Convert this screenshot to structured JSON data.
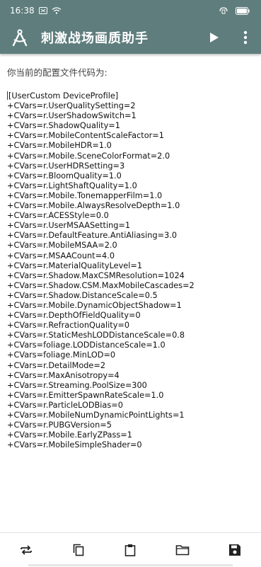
{
  "status_bar": {
    "time": "16:38",
    "battery_icon": "battery-icon",
    "wifi_icon": "wifi-icon"
  },
  "app_bar": {
    "title": "刺激战场画质助手",
    "logo_icon": "compass-drafting-icon",
    "play_icon": "play-icon",
    "menu_icon": "more-vertical-icon",
    "background": "#5f7d7d"
  },
  "main": {
    "prompt": "你当前的配置文件代码为:",
    "config_lines": [
      "[UserCustom DeviceProfile]",
      "+CVars=r.UserQualitySetting=2",
      "+CVars=r.UserShadowSwitch=1",
      "+CVars=r.ShadowQuality=1",
      "+CVars=r.MobileContentScaleFactor=1",
      "+CVars=r.MobileHDR=1.0",
      "+CVars=r.Mobile.SceneColorFormat=2.0",
      "+CVars=r.UserHDRSetting=3",
      "+CVars=r.BloomQuality=1.0",
      "+CVars=r.LightShaftQuality=1.0",
      "+CVars=r.Mobile.TonemapperFilm=1.0",
      "+CVars=r.Mobile.AlwaysResolveDepth=1.0",
      "+CVars=r.ACESStyle=0.0",
      "+CVars=r.UserMSAASetting=1",
      "+CVars=r.DefaultFeature.AntiAliasing=3.0",
      "+CVars=r.MobileMSAA=2.0",
      "+CVars=r.MSAACount=4.0",
      "+CVars=r.MaterialQualityLevel=1",
      "+CVars=r.Shadow.MaxCSMResolution=1024",
      "+CVars=r.Shadow.CSM.MaxMobileCascades=2",
      "+CVars=r.Shadow.DistanceScale=0.5",
      "+CVars=r.Mobile.DynamicObjectShadow=1",
      "+CVars=r.DepthOfFieldQuality=0",
      "+CVars=r.RefractionQuality=0",
      "+CVars=r.StaticMeshLODDistanceScale=0.8",
      "+CVars=foliage.LODDistanceScale=1.0",
      "+CVars=foliage.MinLOD=0",
      "+CVars=r.DetailMode=2",
      "+CVars=r.MaxAnisotropy=4",
      "+CVars=r.Streaming.PoolSize=300",
      "+CVars=r.EmitterSpawnRateScale=1.0",
      "+CVars=r.ParticleLODBias=0",
      "+CVars=r.MobileNumDynamicPointLights=1",
      "+CVars=r.PUBGVersion=5",
      "+CVars=r.Mobile.EarlyZPass=1",
      "+CVars=r.MobileSimpleShader=0"
    ]
  },
  "bottom_bar": {
    "buttons": [
      {
        "icon": "swap-icon"
      },
      {
        "icon": "copy-icon"
      },
      {
        "icon": "clipboard-icon"
      },
      {
        "icon": "folder-icon"
      },
      {
        "icon": "save-icon"
      }
    ]
  }
}
